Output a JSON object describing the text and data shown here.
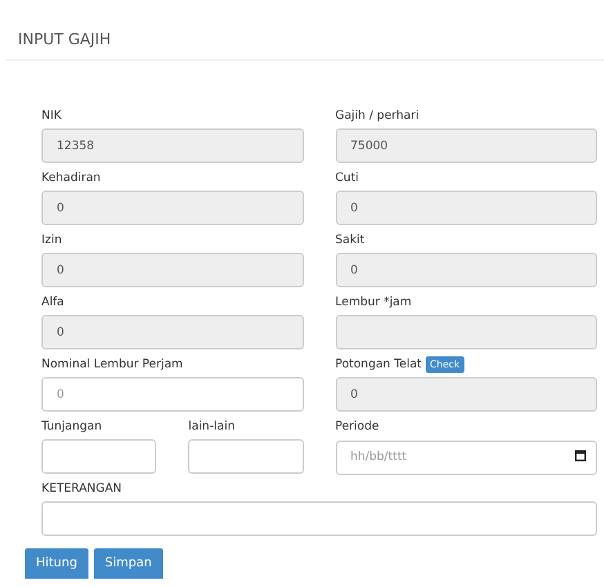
{
  "title": "INPUT GAJIH",
  "fields": [
    {
      "label": "NIK",
      "kind": "half",
      "value": "12358",
      "readonly": true
    },
    {
      "label": "Gajih / perhari",
      "kind": "half",
      "value": "75000",
      "readonly": true
    },
    {
      "label": "Kehadiran",
      "kind": "half",
      "value": "0",
      "readonly": true
    },
    {
      "label": "Cuti",
      "kind": "half",
      "value": "0",
      "readonly": true
    },
    {
      "label": "Izin",
      "kind": "half",
      "value": "0",
      "readonly": true
    },
    {
      "label": "Sakit",
      "kind": "half",
      "value": "0",
      "readonly": true
    },
    {
      "label": "Alfa",
      "kind": "half",
      "value": "0",
      "readonly": true
    },
    {
      "label": "Lembur *jam",
      "kind": "half",
      "readonly": true
    },
    {
      "label": "Nominal Lembur Perjam",
      "kind": "half",
      "placeholder": "0",
      "readonly": false
    },
    {
      "label": "Potongan Telat",
      "kind": "half",
      "value": "0",
      "readonly": true,
      "button": "Check"
    },
    {
      "label": "Tunjangan",
      "kind": "quarter",
      "readonly": false
    },
    {
      "label": "lain-lain",
      "kind": "quarter",
      "readonly": false
    },
    {
      "label": "Periode",
      "kind": "date",
      "placeholder": "hh/bb/tttt",
      "readonly": false
    },
    {
      "label": "KETERANGAN",
      "kind": "full",
      "readonly": false
    }
  ],
  "buttons": [
    "Hitung",
    "Simpan"
  ]
}
